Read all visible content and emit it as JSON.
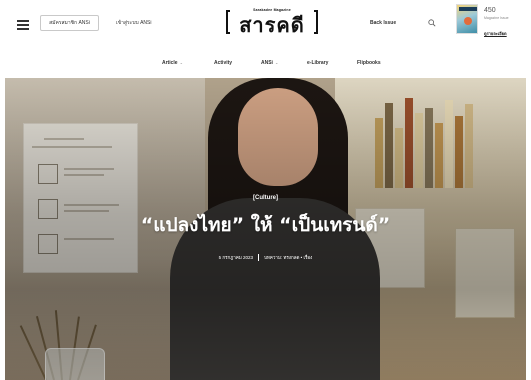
{
  "header": {
    "member_button": "สมัครสมาชิก ANSi",
    "join_link": "เข้าสู่ระบบ ANSi",
    "logo_main": "สารคดี",
    "logo_sub": "Sarakadee Magazine",
    "back_issue": "Back Issue",
    "issue_number": "450",
    "issue_sub": "Magazine Issue",
    "issue_button": "ดูรายละเอียด"
  },
  "nav": {
    "items": [
      {
        "label": "Article",
        "has_dropdown": true
      },
      {
        "label": "Activity",
        "has_dropdown": false
      },
      {
        "label": "ANSi",
        "has_dropdown": true
      },
      {
        "label": "e-Library",
        "has_dropdown": false
      },
      {
        "label": "Flipbooks",
        "has_dropdown": false
      }
    ],
    "chevron": "⌄"
  },
  "hero": {
    "category": "[Culture]",
    "title": "“แปลงไทย” ให้ “เป็นเทรนด์”",
    "date": "5 กรกฎาคม 2023",
    "author": "บทความ: ทรงกลด • เรื่อง"
  }
}
